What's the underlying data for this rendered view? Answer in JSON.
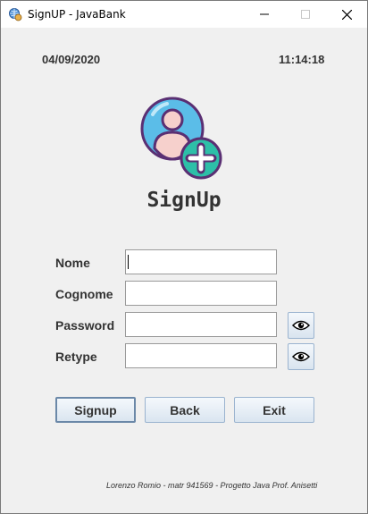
{
  "window": {
    "title": "SignUP - JavaBank",
    "icon": "bank-globe-icon"
  },
  "header": {
    "date": "04/09/2020",
    "time": "11:14:18"
  },
  "logo": {
    "icon": "add-user-icon",
    "colors": {
      "circle": "#5bbde8",
      "outline": "#5a2f73",
      "plus_badge": "#2dbfa8"
    }
  },
  "form": {
    "heading": "SignUp",
    "fields": [
      {
        "label": "Nome",
        "value": ""
      },
      {
        "label": "Cognome",
        "value": ""
      },
      {
        "label": "Password",
        "value": "",
        "toggle_icon": "eye-icon"
      },
      {
        "label": "Retype",
        "value": "",
        "toggle_icon": "eye-icon"
      }
    ]
  },
  "buttons": {
    "signup": "Signup",
    "back": "Back",
    "exit": "Exit"
  },
  "footer": {
    "credits": "Lorenzo Romio - matr 941569 - Progetto Java Prof. Anisetti"
  }
}
